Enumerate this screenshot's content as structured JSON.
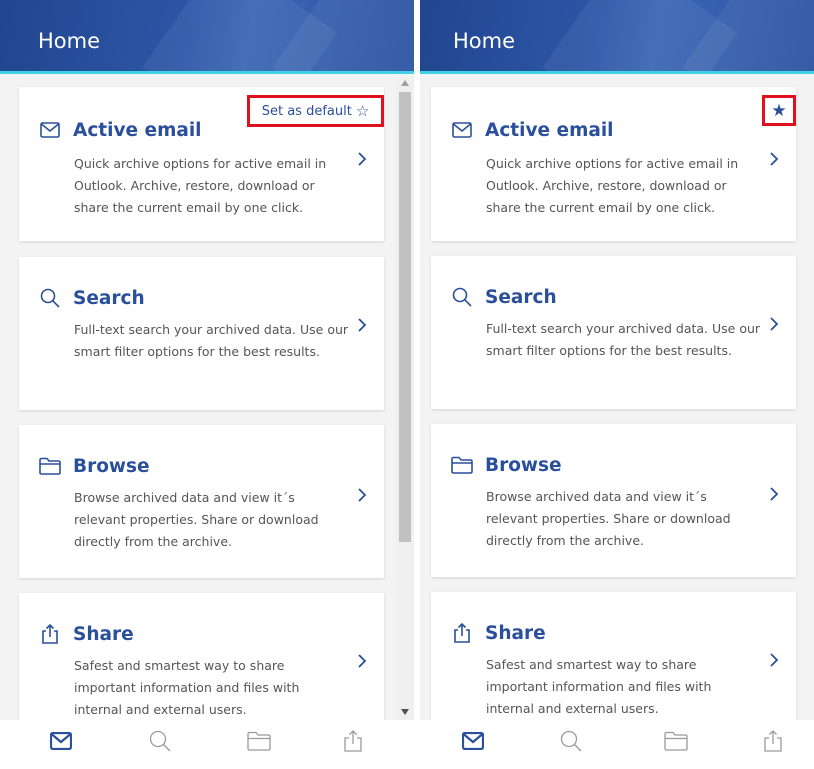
{
  "screens": [
    {
      "header_title": "Home",
      "cards": [
        {
          "icon": "envelope-icon",
          "title": "Active email",
          "description": "Quick archive options for active email in Outlook. Archive, restore, download or share the current email by one click."
        },
        {
          "icon": "search-icon",
          "title": "Search",
          "description": "Full-text search your archived data. Use our smart filter options for the best results."
        },
        {
          "icon": "folder-icon",
          "title": "Browse",
          "description": "Browse archived data and view it´s relevant properties. Share or download directly from the archive."
        },
        {
          "icon": "share-icon",
          "title": "Share",
          "description": "Safest and smartest way to share important information and files with internal and external users."
        }
      ],
      "default_control": {
        "label": "Set as default",
        "star": "☆",
        "highlighted": true
      }
    },
    {
      "header_title": "Home",
      "cards": [
        {
          "icon": "envelope-icon",
          "title": "Active email",
          "description": "Quick archive options for active email in Outlook. Archive, restore, download or share the current email by one click."
        },
        {
          "icon": "search-icon",
          "title": "Search",
          "description": "Full-text search your archived data. Use our smart filter options for the best results."
        },
        {
          "icon": "folder-icon",
          "title": "Browse",
          "description": "Browse archived data and view it´s relevant properties. Share or download directly from the archive."
        },
        {
          "icon": "share-icon",
          "title": "Share",
          "description": "Safest and smartest way to share important information and files with internal and external users."
        }
      ],
      "default_control": {
        "star": "★",
        "highlighted": true
      }
    }
  ],
  "bottom_nav": [
    {
      "icon": "envelope-icon",
      "active": true
    },
    {
      "icon": "search-icon",
      "active": false
    },
    {
      "icon": "folder-icon",
      "active": false
    },
    {
      "icon": "share-icon",
      "active": false
    }
  ],
  "colors": {
    "header": "#2c56a6",
    "header_underline": "#3fd1e6",
    "accent": "#2a4f9b",
    "highlight_border": "#e0111f",
    "inactive_icon": "#9a9a9a"
  }
}
